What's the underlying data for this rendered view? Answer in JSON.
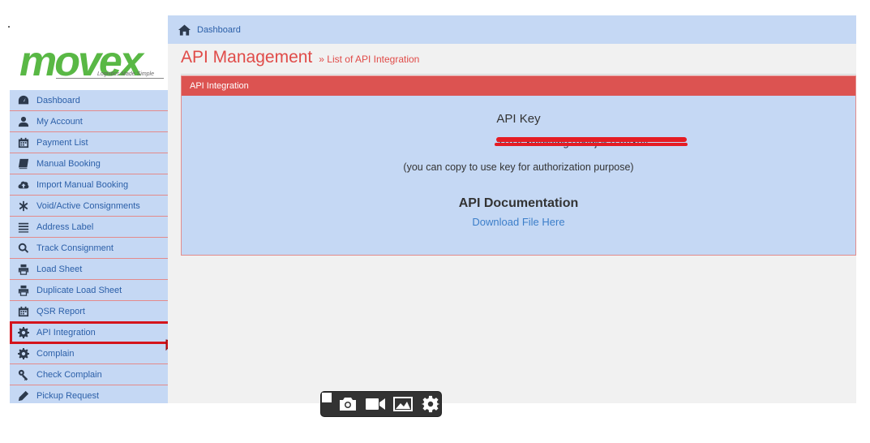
{
  "brand": {
    "logo_text": "movex",
    "tagline": "Logistics Made Simple"
  },
  "sidebar": {
    "items": [
      {
        "label": "Dashboard",
        "icon": "dashboard-icon"
      },
      {
        "label": "My Account",
        "icon": "user-icon"
      },
      {
        "label": "Payment List",
        "icon": "calendar-icon"
      },
      {
        "label": "Manual Booking",
        "icon": "book-icon"
      },
      {
        "label": "Import Manual Booking",
        "icon": "cloud-upload-icon"
      },
      {
        "label": "Void/Active Consignments",
        "icon": "asterisk-icon"
      },
      {
        "label": "Address Label",
        "icon": "list-icon"
      },
      {
        "label": "Track Consignment",
        "icon": "search-icon"
      },
      {
        "label": "Load Sheet",
        "icon": "print-icon"
      },
      {
        "label": "Duplicate Load Sheet",
        "icon": "print-icon"
      },
      {
        "label": "QSR Report",
        "icon": "calendar-icon"
      },
      {
        "label": "API Integration",
        "icon": "gear-icon"
      },
      {
        "label": "Complain",
        "icon": "gear-icon"
      },
      {
        "label": "Check Complain",
        "icon": "key-icon"
      },
      {
        "label": "Pickup Request",
        "icon": "pencil-icon"
      }
    ],
    "active": "API Integration"
  },
  "breadcrumb": {
    "label": "Dashboard"
  },
  "page": {
    "title": "API Management",
    "subtitle": "» List of API Integration"
  },
  "panel": {
    "header": "API Integration",
    "api_key_label": "API Key",
    "api_key_value": "a1b2c3d4e5f6g7h8i9j0k1l2m3n4",
    "copy_note": "(you can copy to use key for authorization purpose)",
    "doc_title": "API Documentation",
    "doc_link": "Download File Here"
  },
  "colors": {
    "accent_red": "#dc5351",
    "sidebar_bg": "#c5d8f4",
    "link_blue": "#3c7ec9",
    "brand_green": "#59b845"
  }
}
